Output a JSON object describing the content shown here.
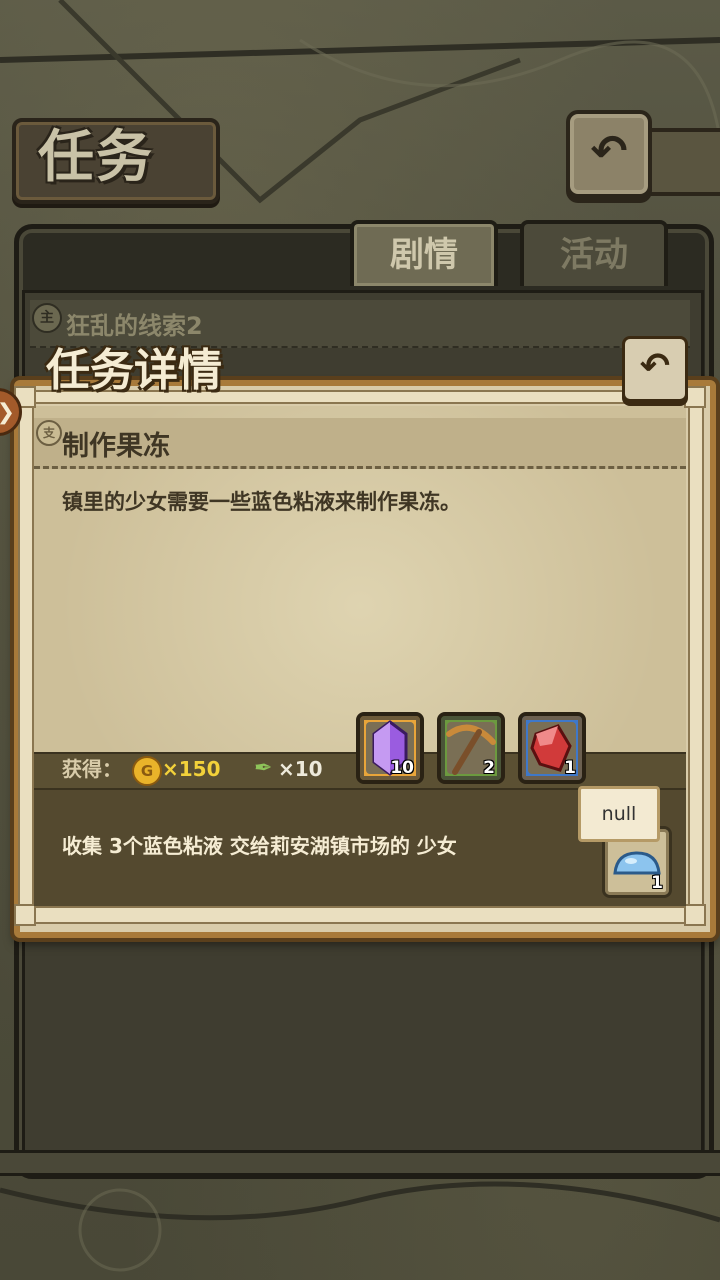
{
  "header": {
    "title": "任务",
    "back_icon": "back-arrow-icon"
  },
  "tabs": [
    {
      "label": "剧情",
      "active": true
    },
    {
      "label": "活动",
      "active": false
    }
  ],
  "quest_list": {
    "type_badge": "主",
    "current_quest": "狂乱的线索2"
  },
  "detail": {
    "title": "任务详情",
    "type_badge": "支",
    "quest_name": "制作果冻",
    "description": "镇里的少女需要一些蓝色粘液来制作果冻。",
    "reward_label": "获得：",
    "coin_symbol": "G",
    "coin_amount": "×150",
    "exp_amount": "×10",
    "items": [
      {
        "icon": "purple-crystal-icon",
        "count": "10",
        "rarity_color": "#e9a53a"
      },
      {
        "icon": "pickaxe-icon",
        "count": "2",
        "rarity_color": "#6c9a3f"
      },
      {
        "icon": "ruby-ore-icon",
        "count": "1",
        "rarity_color": "#3f78c9"
      }
    ],
    "objective": "收集 3个蓝色粘液 交给莉安湖镇市场的 少女",
    "target_item": {
      "icon": "blue-slime-icon",
      "count": "1"
    },
    "tooltip": "null"
  }
}
